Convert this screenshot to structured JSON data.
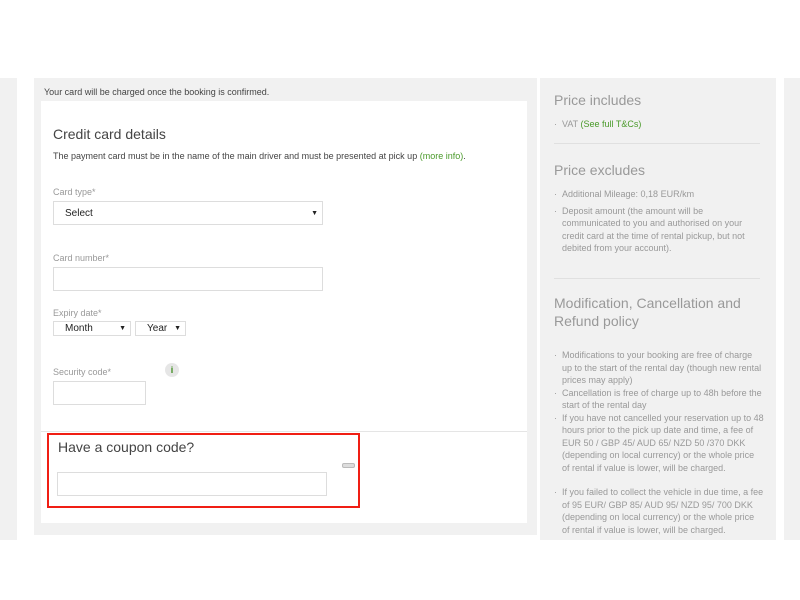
{
  "main": {
    "charge_note": "Your card will be charged once the booking is confirmed.",
    "credit_card": {
      "title": "Credit card details",
      "description": "The payment card must be in the name of the main driver and must be presented at pick up",
      "more_info_link": "(more info)",
      "description_end": ".",
      "card_type_label": "Card type*",
      "card_type_value": "Select",
      "card_number_label": "Card number*",
      "card_number_value": "",
      "expiry_label": "Expiry date*",
      "expiry_month": "Month",
      "expiry_year": "Year",
      "security_label": "Security code*",
      "security_value": "",
      "info_icon": "i"
    },
    "coupon": {
      "title": "Have a coupon code?",
      "value": ""
    },
    "highlight_color": "#f01e14",
    "link_color": "#4a9a2a"
  },
  "sidebar": {
    "includes_title": "Price includes",
    "includes_item": "VAT",
    "includes_link": "(See full T&Cs)",
    "excludes_title": "Price excludes",
    "excludes_items": [
      "Additional Mileage: 0,18 EUR/km",
      "Deposit amount (the amount will be communicated to you and authorised on your credit card at the time of rental pickup, but not debited from your account)."
    ],
    "policy_title": "Modification, Cancellation and Refund policy",
    "policy_items": [
      "Modifications to your booking are free of charge up to the start of the rental day (though new rental prices may apply)",
      "Cancellation is free of charge up to 48h before the start of the rental day",
      "If you have not cancelled your reservation up to 48 hours prior to the pick up date and time, a fee of EUR 50 / GBP 45/ AUD 65/ NZD 50 /370 DKK (depending on local currency) or the whole price of rental if value is lower, will be charged.",
      "If you failed to collect the vehicle in due time, a fee of 95 EUR/ GBP 85/ AUD 95/ NZD 95/ 700 DKK (depending on local currency) or the whole price of rental if value is lower, will be charged."
    ]
  }
}
